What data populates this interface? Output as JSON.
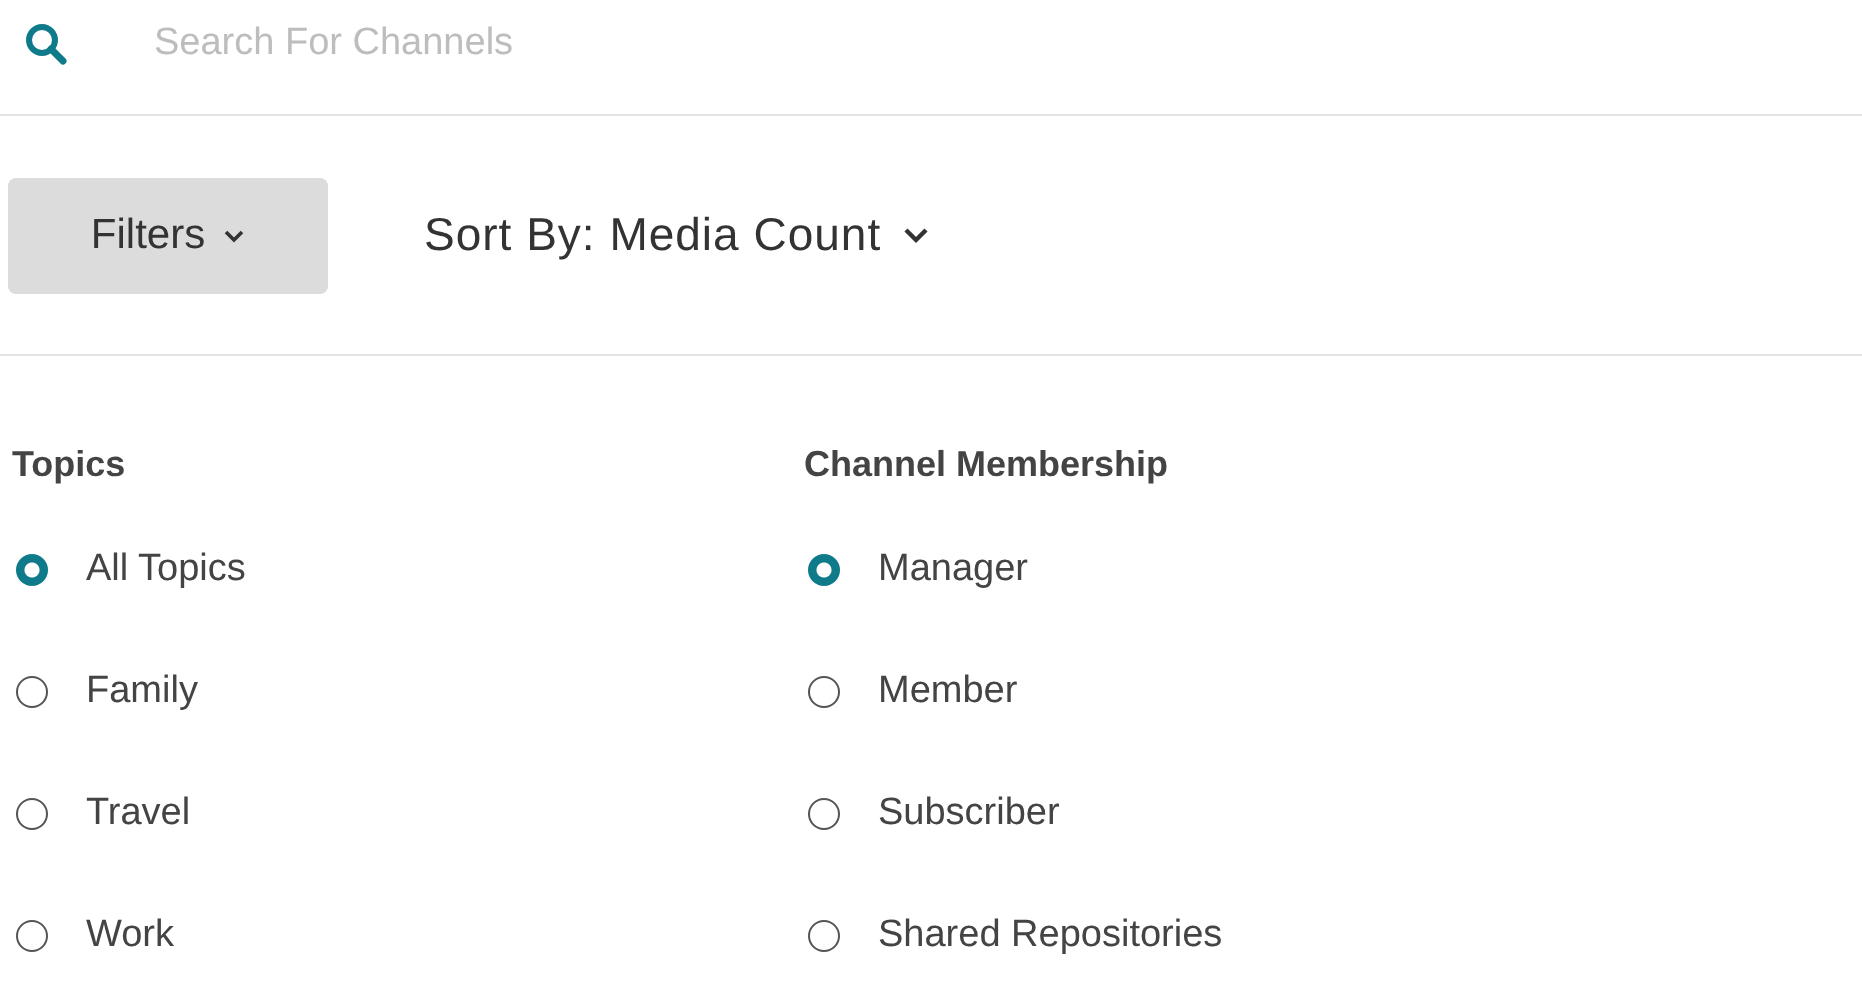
{
  "search": {
    "placeholder": "Search For Channels"
  },
  "filters_button": {
    "label": "Filters"
  },
  "sort": {
    "label": "Sort By: Media Count"
  },
  "groups": [
    {
      "title": "Topics",
      "options": [
        {
          "label": "All Topics",
          "selected": true
        },
        {
          "label": "Family",
          "selected": false
        },
        {
          "label": "Travel",
          "selected": false
        },
        {
          "label": "Work",
          "selected": false
        }
      ]
    },
    {
      "title": "Channel Membership",
      "options": [
        {
          "label": "Manager",
          "selected": true
        },
        {
          "label": "Member",
          "selected": false
        },
        {
          "label": "Subscriber",
          "selected": false
        },
        {
          "label": "Shared Repositories",
          "selected": false
        }
      ]
    }
  ]
}
